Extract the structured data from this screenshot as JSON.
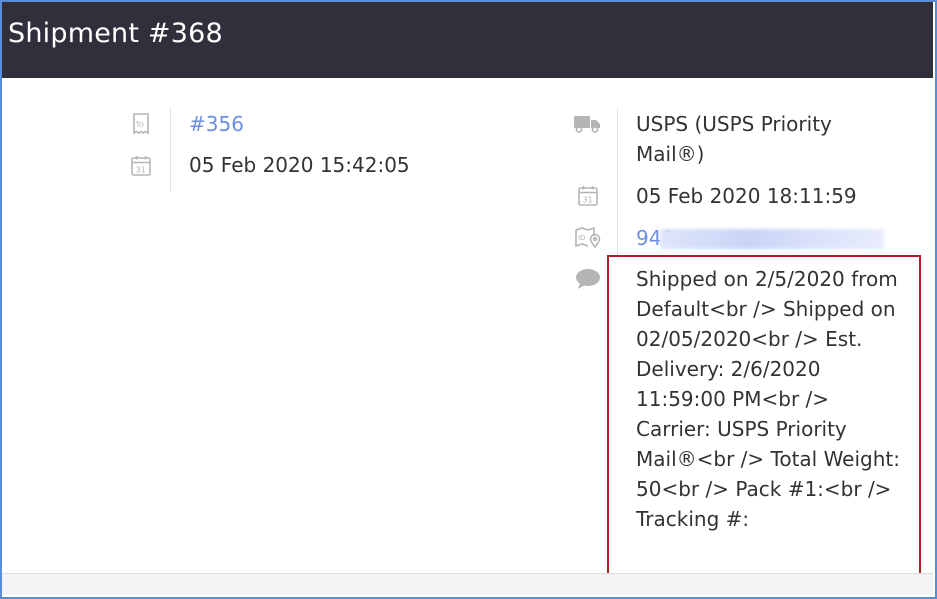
{
  "header": {
    "title": "Shipment #368"
  },
  "order": {
    "id_link": "#356",
    "date": "05 Feb 2020 15:42:05"
  },
  "shipment": {
    "carrier": "USPS (USPS Priority Mail®)",
    "ship_date": "05 Feb 2020 18:11:59",
    "tracking_prefix": "940",
    "notes": "Shipped on 2/5/2020 from Default<br /> Shipped on 02/05/2020<br /> Est. Delivery: 2/6/2020 11:59:00 PM<br /> Carrier: USPS Priority Mail®<br /> Total Weight: 50<br /> Pack #1:<br /> Tracking #:"
  },
  "icons": {
    "order": "receipt-id-icon",
    "order_date": "calendar-icon",
    "carrier": "truck-icon",
    "ship_date": "calendar-icon",
    "tracking": "id-location-icon",
    "notes": "comment-icon"
  },
  "colors": {
    "header_bg": "#302f3b",
    "link": "#6b8fe0",
    "highlight_border": "#b01f24",
    "frame_border": "#5b8dd6"
  }
}
